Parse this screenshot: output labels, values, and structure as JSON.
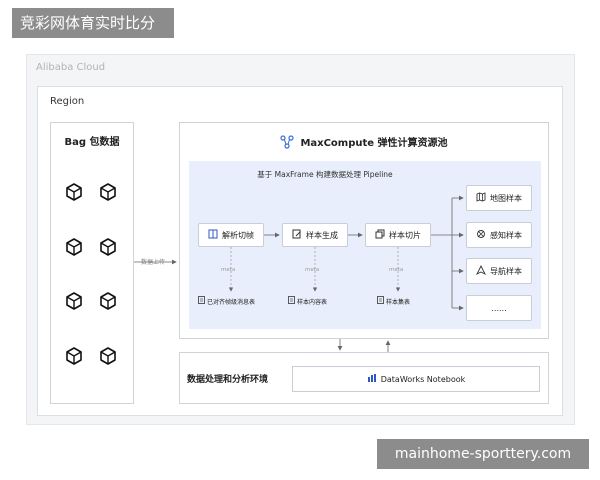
{
  "banner_top": "竞彩网体育实时比分",
  "banner_bottom": "mainhome-sporttery.com",
  "cloud_label": "Alibaba Cloud",
  "region_label": "Region",
  "bag": {
    "title": "Bag 包数据",
    "icon": "cube-icon"
  },
  "upload_label": "数据上传",
  "maxcompute": {
    "title": "MaxCompute 弹性计算资源池",
    "icon": "network-icon"
  },
  "maxframe": {
    "title": "基于 MaxFrame 构建数据处理 Pipeline"
  },
  "steps": [
    {
      "label": "解析切帧",
      "icon": "book-icon"
    },
    {
      "label": "样本生成",
      "icon": "edit-icon"
    },
    {
      "label": "样本切片",
      "icon": "copy-icon"
    }
  ],
  "meta_label": "meta",
  "docs": [
    {
      "label": "已对齐帧级消息表",
      "icon": "doc-icon"
    },
    {
      "label": "样本内容表",
      "icon": "doc-icon"
    },
    {
      "label": "样本集表",
      "icon": "doc-icon"
    }
  ],
  "outputs": [
    {
      "label": "地图样本",
      "icon": "map-icon"
    },
    {
      "label": "感知样本",
      "icon": "perception-icon"
    },
    {
      "label": "导航样本",
      "icon": "navigation-icon"
    },
    {
      "label": "......",
      "icon": ""
    }
  ],
  "bottom": {
    "label": "数据处理和分析环境",
    "notebook": "DataWorks Notebook",
    "notebook_icon": "dataworks-icon"
  }
}
